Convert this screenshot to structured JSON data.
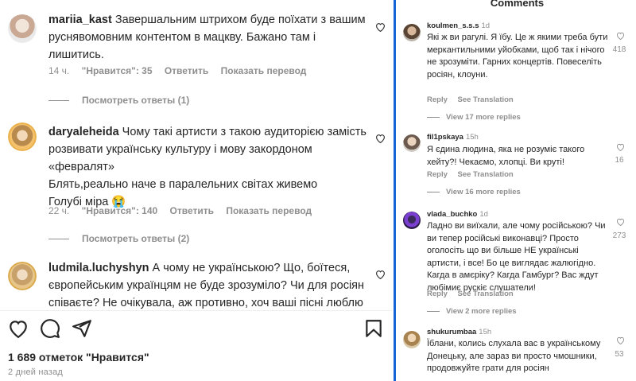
{
  "left": {
    "comments": [
      {
        "username": "mariia_kast",
        "text": "Завершальним штрихом буде поїхати з вашим руснявомовним контентом в мацкву. Бажано там і лишитись.",
        "time": "14 ч.",
        "likes": "\"Нравится\": 35",
        "reply": "Ответить",
        "translate": "Показать перевод",
        "view_replies": "Посмотреть ответы (1)"
      },
      {
        "username": "daryaleheida",
        "text_lines": [
          "Чому такі артисти з такою аудиторією замість розвивати українську культуру і мову закордоном «февралят»",
          "Блять,реально наче в паралельних світах живемо",
          "Голубі міра 😭"
        ],
        "time": "22 ч.",
        "likes": "\"Нравится\": 140",
        "reply": "Ответить",
        "translate": "Показать перевод",
        "view_replies": "Посмотреть ответы (2)"
      },
      {
        "username": "ludmila.luchyshyn",
        "text": "А чому не українською? Що, боїтеся, європейським українцям не буде зрозуміло? Чи для росіян співаєте? Не очікувала, аж противно, хоч ваші пісні люблю"
      }
    ],
    "post": {
      "likes_count": "1 689 отметок \"Нравится\"",
      "posted_ago": "2 дней назад"
    }
  },
  "right": {
    "title": "Comments",
    "comments": [
      {
        "username": "koulmen_s.s.s",
        "time": "1d",
        "text": "Які ж ви рагулі. Я їбу. Це ж якими треба бути меркантильними уйобками, щоб так і нічого не зрозуміти. Гарних концертів. Повеселіть росіян, клоуни.",
        "reply": "Reply",
        "translate": "See Translation",
        "more": "View 17 more replies",
        "likes": "418"
      },
      {
        "username": "fil1pskaya",
        "time": "15h",
        "text": "Я єдина людина, яка не розуміє такого хейту?! Чекаємо, хлопці. Ви круті!",
        "reply": "Reply",
        "translate": "See Translation",
        "more": "View 16 more replies",
        "likes": "16"
      },
      {
        "username": "vlada_buchko",
        "time": "1d",
        "text": "Ладно ви виїхали, але чому російською? Чи ви тепер російські виконавці? Просто оголосіть що ви більше НЕ українські артисти, і все! Бо це виглядає жалюгідно. Кагда в амєріку? Кагда Гамбург? Вас ждут любімиє рускіє слушатели!",
        "reply": "Reply",
        "translate": "See Translation",
        "more": "View 2 more replies",
        "likes": "273"
      },
      {
        "username": "shukurumbaa",
        "time": "15h",
        "text": "Їблани, колись слухала вас в українському Донецьку, але зараз ви просто чмошники, продовжуйте грати для росіян",
        "likes": "53"
      }
    ]
  },
  "colors": {
    "separator": "#1565d8",
    "muted": "#8e8e8e",
    "text": "#262626"
  }
}
